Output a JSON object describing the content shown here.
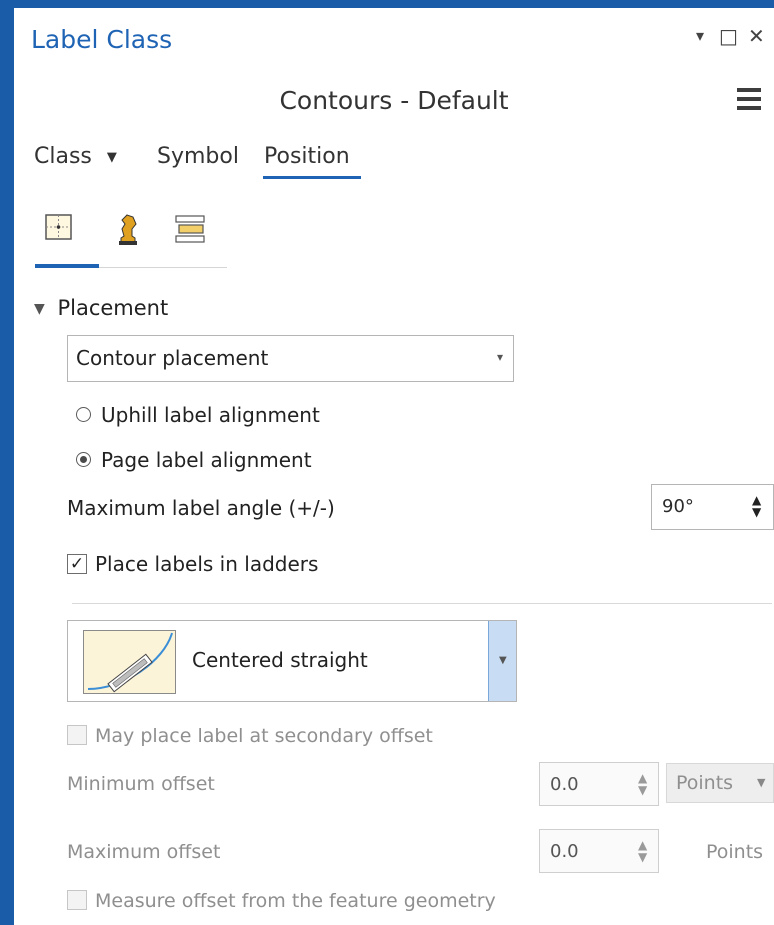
{
  "window": {
    "title": "Label Class",
    "controls": {
      "pin": "▾",
      "maximize": "□",
      "close": "✕"
    },
    "accent_color": "#1f64b4",
    "frame_color": "#1b5ca8"
  },
  "header": {
    "layer_name": "Contours - Default"
  },
  "tabs": [
    {
      "label": "Class",
      "has_dropdown": true,
      "active": false
    },
    {
      "label": "Symbol",
      "active": false
    },
    {
      "label": "Position",
      "active": true
    }
  ],
  "subtabs": [
    {
      "icon": "placement-icon",
      "active": true
    },
    {
      "icon": "conflict-resolution-icon",
      "active": false
    },
    {
      "icon": "fitting-strategy-icon",
      "active": false
    }
  ],
  "placement": {
    "section_title": "Placement",
    "placement_type": "Contour placement",
    "alignment_options": [
      {
        "label": "Uphill label alignment",
        "selected": false
      },
      {
        "label": "Page label alignment",
        "selected": true
      }
    ],
    "max_angle_label": "Maximum label angle (+/-)",
    "max_angle_value": "90°",
    "ladders_label": "Place labels in ladders",
    "ladders_checked": true,
    "position_style": "Centered straight",
    "secondary_offset_label": "May place label at secondary offset",
    "min_offset_label": "Minimum offset",
    "min_offset_value": "0.0",
    "min_offset_units": "Points",
    "max_offset_label": "Maximum offset",
    "max_offset_value": "0.0",
    "max_offset_units": "Points",
    "measure_offset_label": "Measure offset from the feature geometry"
  }
}
